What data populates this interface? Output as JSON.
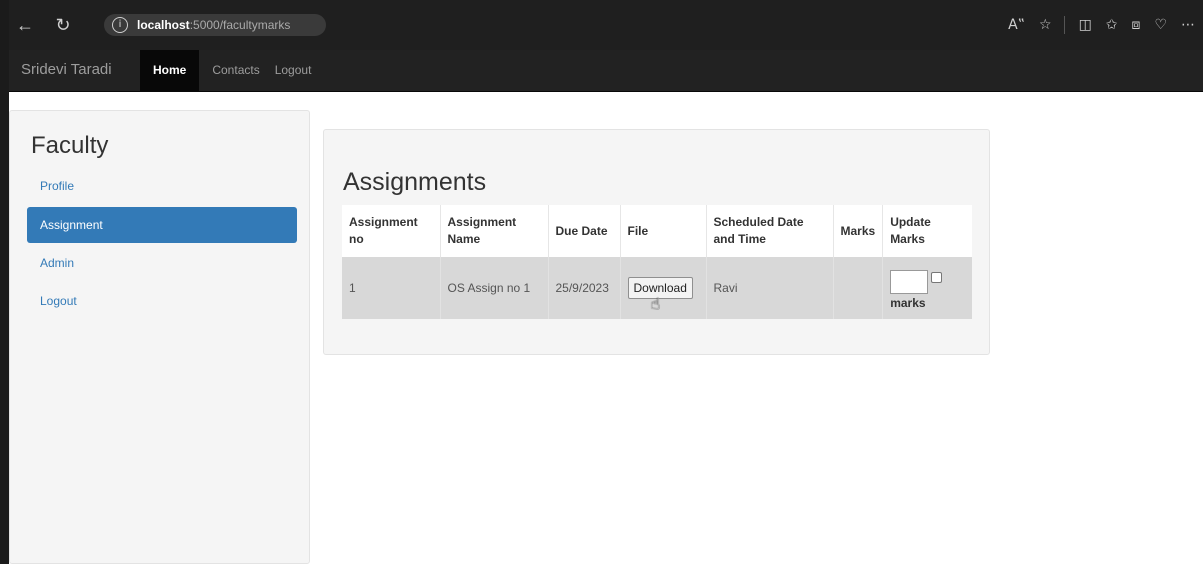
{
  "browser": {
    "url_host": "localhost",
    "url_path": ":5000/facultymarks",
    "icons": [
      "back-icon",
      "refresh-icon",
      "info-icon",
      "read-aloud-icon",
      "favorite-icon",
      "split-screen-icon",
      "favorites-list-icon",
      "collections-icon",
      "health-icon",
      "more-icon"
    ]
  },
  "navbar": {
    "brand": "Sridevi Taradi",
    "links": [
      "Home",
      "Contacts",
      "Logout"
    ],
    "active": "Home"
  },
  "sidebar": {
    "title": "Faculty",
    "items": [
      {
        "label": "Profile",
        "active": false
      },
      {
        "label": "Assignment",
        "active": true
      },
      {
        "label": "Admin",
        "active": false
      },
      {
        "label": "Logout",
        "active": false
      }
    ]
  },
  "main": {
    "title": "Assignments",
    "table": {
      "headers": {
        "no_1": "Assignment",
        "no_2": "no",
        "name_1": "Assignment",
        "name_2": "Name",
        "due": "Due Date",
        "file": "File",
        "sched_1": "Scheduled Date",
        "sched_2": "and Time",
        "marks": "Marks",
        "update_1": "Update",
        "update_2": "Marks"
      },
      "rows": [
        {
          "no": "1",
          "name": "OS Assign no 1",
          "due": "25/9/2023",
          "file_button": "Download",
          "scheduled": "Ravi",
          "marks": "",
          "update_label": "marks"
        }
      ]
    }
  },
  "colors": {
    "primary": "#337ab7",
    "navbar": "#222222",
    "browser": "#1f1f1f"
  }
}
